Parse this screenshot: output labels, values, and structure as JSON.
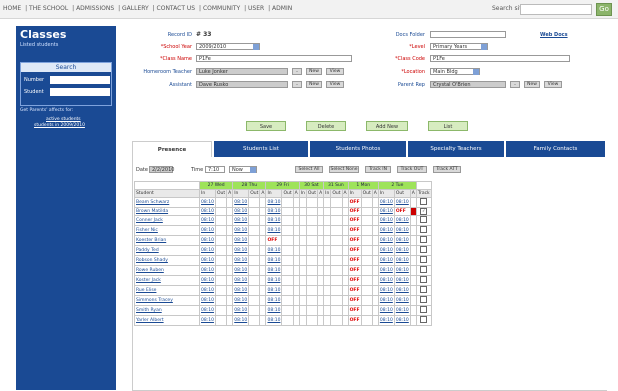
{
  "nav": {
    "links": [
      "HOME",
      "THE SCHOOL",
      "ADMISSIONS",
      "GALLERY",
      "CONTACT US",
      "COMMUNITY",
      "USER",
      "ADMIN"
    ],
    "search_label": "Search site",
    "go_label": "Go"
  },
  "sidebar": {
    "title": "Classes",
    "subtitle": "Listed students",
    "search_header": "Search",
    "number_label": "Number",
    "student_label": "Student",
    "link_intro": "Get Parents' affects for:",
    "link1": "active students",
    "link2": "students in 2009/2010"
  },
  "form": {
    "record_label": "Record ID",
    "record_value": "# 33",
    "school_year_label": "*School Year",
    "school_year_value": "2009/2010",
    "class_name_label": "*Class Name",
    "class_name_value": "P1Fe",
    "homeroom_label": "Homeroom Teacher",
    "homeroom_value": "Luke Jonker",
    "assistant_label": "Assistant",
    "assistant_value": "Dave Rusko",
    "docs_folder_label": "Docs Folder",
    "web_docs_link": "Web Docs",
    "level_label": "*Level",
    "level_value": "Primary Years",
    "class_code_label": "*Class Code",
    "class_code_value": "P1Fe",
    "location_label": "*Location",
    "location_value": "Main Bldg",
    "parent_rep_label": "Parent Rep",
    "parent_rep_value": "Crystal O'Brien",
    "new_label": "New",
    "view_label": "View"
  },
  "actions": [
    "Save",
    "Delete",
    "Add New",
    "List"
  ],
  "tabs": [
    "Presence",
    "Students List",
    "Students Photos",
    "Specialty Teachers",
    "Family Contacts"
  ],
  "controls": {
    "date_label": "Date",
    "date_value": "2/2/2010",
    "time_label": "Time",
    "time_value": "7:10",
    "now_value": "Now",
    "buttons": [
      "Select All",
      "Select None",
      "Track IN",
      "Track OUT",
      "Track ATT"
    ]
  },
  "days": [
    "27 Wed",
    "28 Thu",
    "29 Fri",
    "30 Sat",
    "31 Sun",
    "1 Mon",
    "2 Tue"
  ],
  "columns": {
    "student": "Student",
    "in": "In",
    "out": "Out",
    "abs": "A",
    "track": "Track"
  },
  "time_value": "08:10",
  "off_value": "OFF",
  "students": [
    "Beam Schwarz",
    "Brown Matilda",
    "Conner Jack",
    "Fisher Nic",
    "Koester Brian",
    "Paddy Ted",
    "Robson Shady",
    "Rowe Ruben",
    "Koster Jack",
    "Rue Elise",
    "Simmons Tracey",
    "Smith Ryan",
    "Yarler Albert"
  ]
}
